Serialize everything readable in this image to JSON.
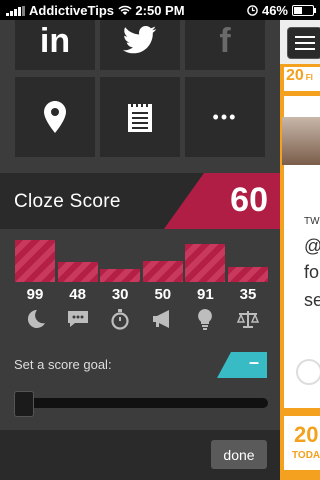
{
  "status_bar": {
    "carrier": "AddictiveTips",
    "time": "2:50 PM",
    "battery": "46%",
    "battery_level": 0.46
  },
  "share_tiles": [
    {
      "icon": "linkedin-icon",
      "label": "in"
    },
    {
      "icon": "twitter-icon"
    },
    {
      "icon": "facebook-icon",
      "label": "f"
    },
    {
      "icon": "location-pin-icon"
    },
    {
      "icon": "notepad-icon"
    },
    {
      "icon": "more-icon",
      "label": "•••"
    }
  ],
  "cloze_score": {
    "title": "Cloze Score",
    "value": "60",
    "accent": "#b01e45"
  },
  "metrics": [
    {
      "value": 99,
      "icon": "moon-icon"
    },
    {
      "value": 48,
      "icon": "chat-icon"
    },
    {
      "value": 30,
      "icon": "stopwatch-icon"
    },
    {
      "value": 50,
      "icon": "megaphone-icon"
    },
    {
      "value": 91,
      "icon": "lightbulb-icon"
    },
    {
      "value": 35,
      "icon": "scales-icon"
    }
  ],
  "goal": {
    "label": "Set a score goal:",
    "toggle": "–",
    "toggle_color": "#38bbc4",
    "slider_value": 0
  },
  "done_label": "done",
  "right_panel": {
    "date_top": "20",
    "date_top_suffix": "FI",
    "text_lines": [
      "TW",
      "@",
      "fo",
      "se"
    ],
    "date_bottom": "20",
    "date_bottom_label": "TODA",
    "accent": "#f3a11e"
  }
}
